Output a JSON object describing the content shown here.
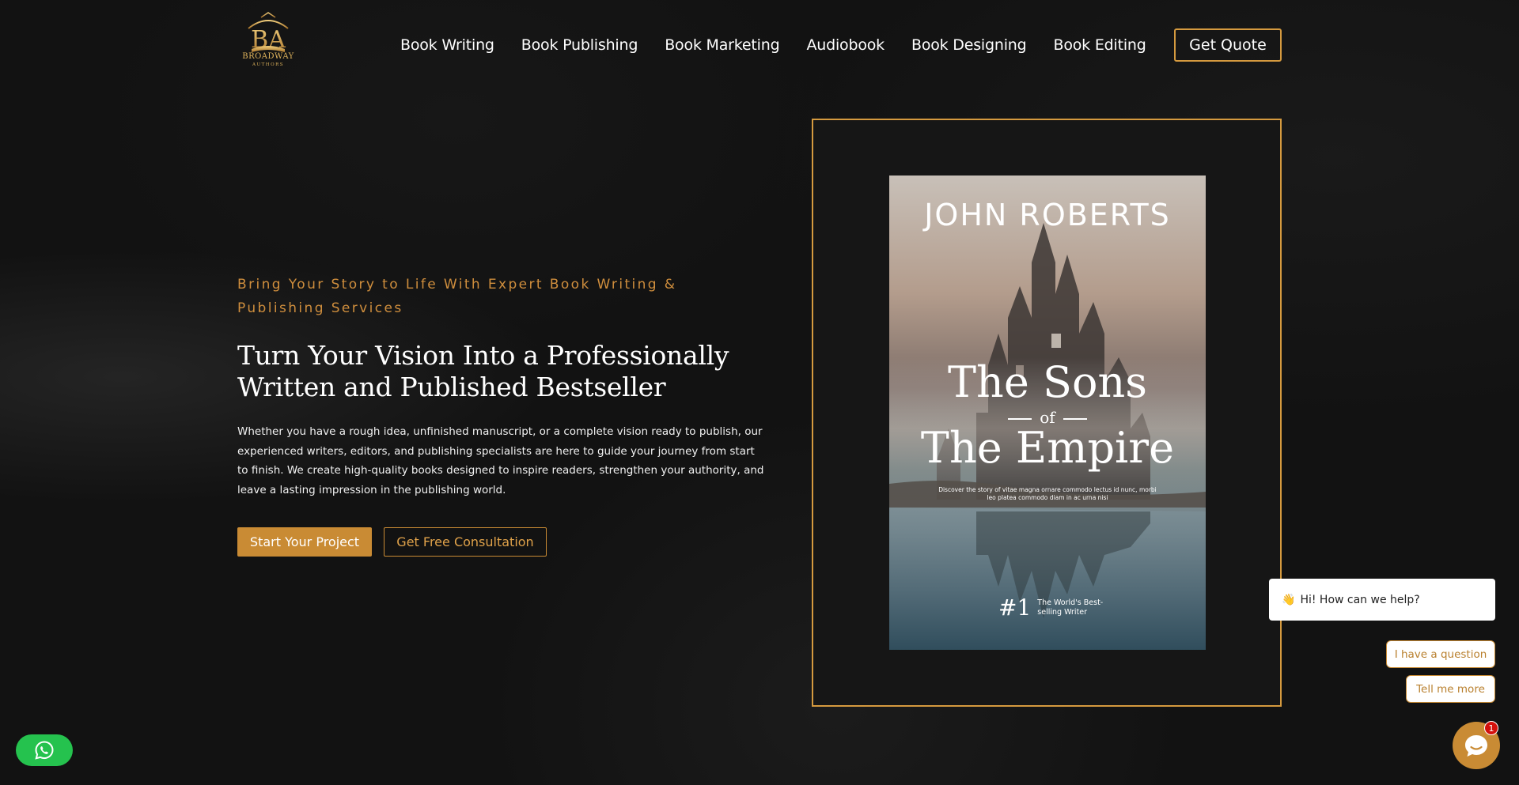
{
  "brand": {
    "name": "BROADWAY",
    "sub": "AUTHORS",
    "monogram": "BA"
  },
  "nav": {
    "items": [
      "Book Writing",
      "Book Publishing",
      "Book Marketing",
      "Audiobook",
      "Book Designing",
      "Book Editing"
    ],
    "cta": "Get Quote"
  },
  "hero": {
    "eyebrow": "Bring Your Story to Life With Expert Book Writing & Publishing Services",
    "headline": "Turn Your Vision Into a Professionally Written and Published Bestseller",
    "description": "Whether you have a rough idea, unfinished manuscript, or a complete vision ready to publish, our experienced writers, editors, and publishing specialists are here to guide your journey from start to finish. We create high-quality books designed to inspire readers, strengthen your authority, and leave a lasting impression in the publishing world.",
    "primary_button": "Start Your Project",
    "secondary_button": "Get Free Consultation"
  },
  "book": {
    "author": "JOHN ROBERTS",
    "title_line1": "The Sons",
    "title_of": "of",
    "title_line2": "The Empire",
    "blurb": "Discover the story of vitae magna ornare commodo lectus id nunc, morbi leo platea commodo diam in ac urna nisi",
    "rank": "#1",
    "rank_text": "The World's Best-selling Writer"
  },
  "chat": {
    "greeting_icon": "wave-hand-icon",
    "greeting": "Hi! How can we help?",
    "options": [
      "I have a question",
      "Tell me more"
    ],
    "badge_count": "1"
  },
  "colors": {
    "accent": "#c98b34",
    "background": "#121212",
    "whatsapp": "#25c24e",
    "badge": "#d4100c"
  }
}
